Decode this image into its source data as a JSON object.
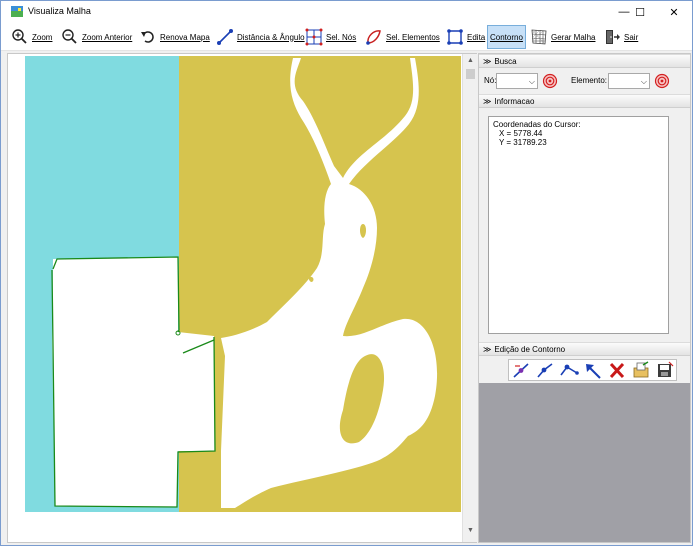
{
  "window": {
    "title": "Visualiza Malha",
    "minimize_glyph": "—",
    "maximize_glyph": "☐",
    "close_glyph": "✕"
  },
  "toolbar": {
    "items": [
      {
        "label": "Zoom",
        "icon": "zoom-in-icon"
      },
      {
        "label": "Zoom Anterior",
        "icon": "zoom-out-icon"
      },
      {
        "label": "Renova Mapa",
        "icon": "undo-arrow-icon"
      },
      {
        "label": "Distância & Ângulo",
        "icon": "distance-angle-icon"
      },
      {
        "label": "Sel. Nós",
        "icon": "select-nodes-icon"
      },
      {
        "label": "Sel. Elementos",
        "icon": "select-elements-icon"
      },
      {
        "label": "Edita",
        "icon": "edit-polygon-icon"
      },
      {
        "label": "Contorno",
        "icon": "contour-icon"
      },
      {
        "label": "Gerar Malha",
        "icon": "mesh-grid-icon"
      },
      {
        "label": "Sair",
        "icon": "exit-door-icon"
      }
    ],
    "active": "Contorno"
  },
  "map": {
    "colors": {
      "water": "#80dbe0",
      "land": "#d6c44e",
      "mesh_region": "#ffffff",
      "contour_line": "#1a8a1a"
    },
    "scrollbar": {
      "up_arrow": "▲",
      "down_arrow": "▼"
    }
  },
  "panel": {
    "busca": {
      "title": "Busca",
      "node_label": "Nó:",
      "element_label": "Elemento:",
      "node_value": "",
      "element_value": ""
    },
    "informacao": {
      "title": "Informacao",
      "heading": "Coordenadas do Cursor:",
      "x_line": "X = 5778.44",
      "y_line": "Y = 31789.23"
    },
    "edicao": {
      "title": "Edição de Contorno",
      "tools": [
        "add-point-icon",
        "insert-node-icon",
        "split-segment-icon",
        "pointer-arrow-icon",
        "delete-x-icon",
        "open-file-icon",
        "save-file-icon"
      ]
    },
    "chevron": "≫"
  }
}
